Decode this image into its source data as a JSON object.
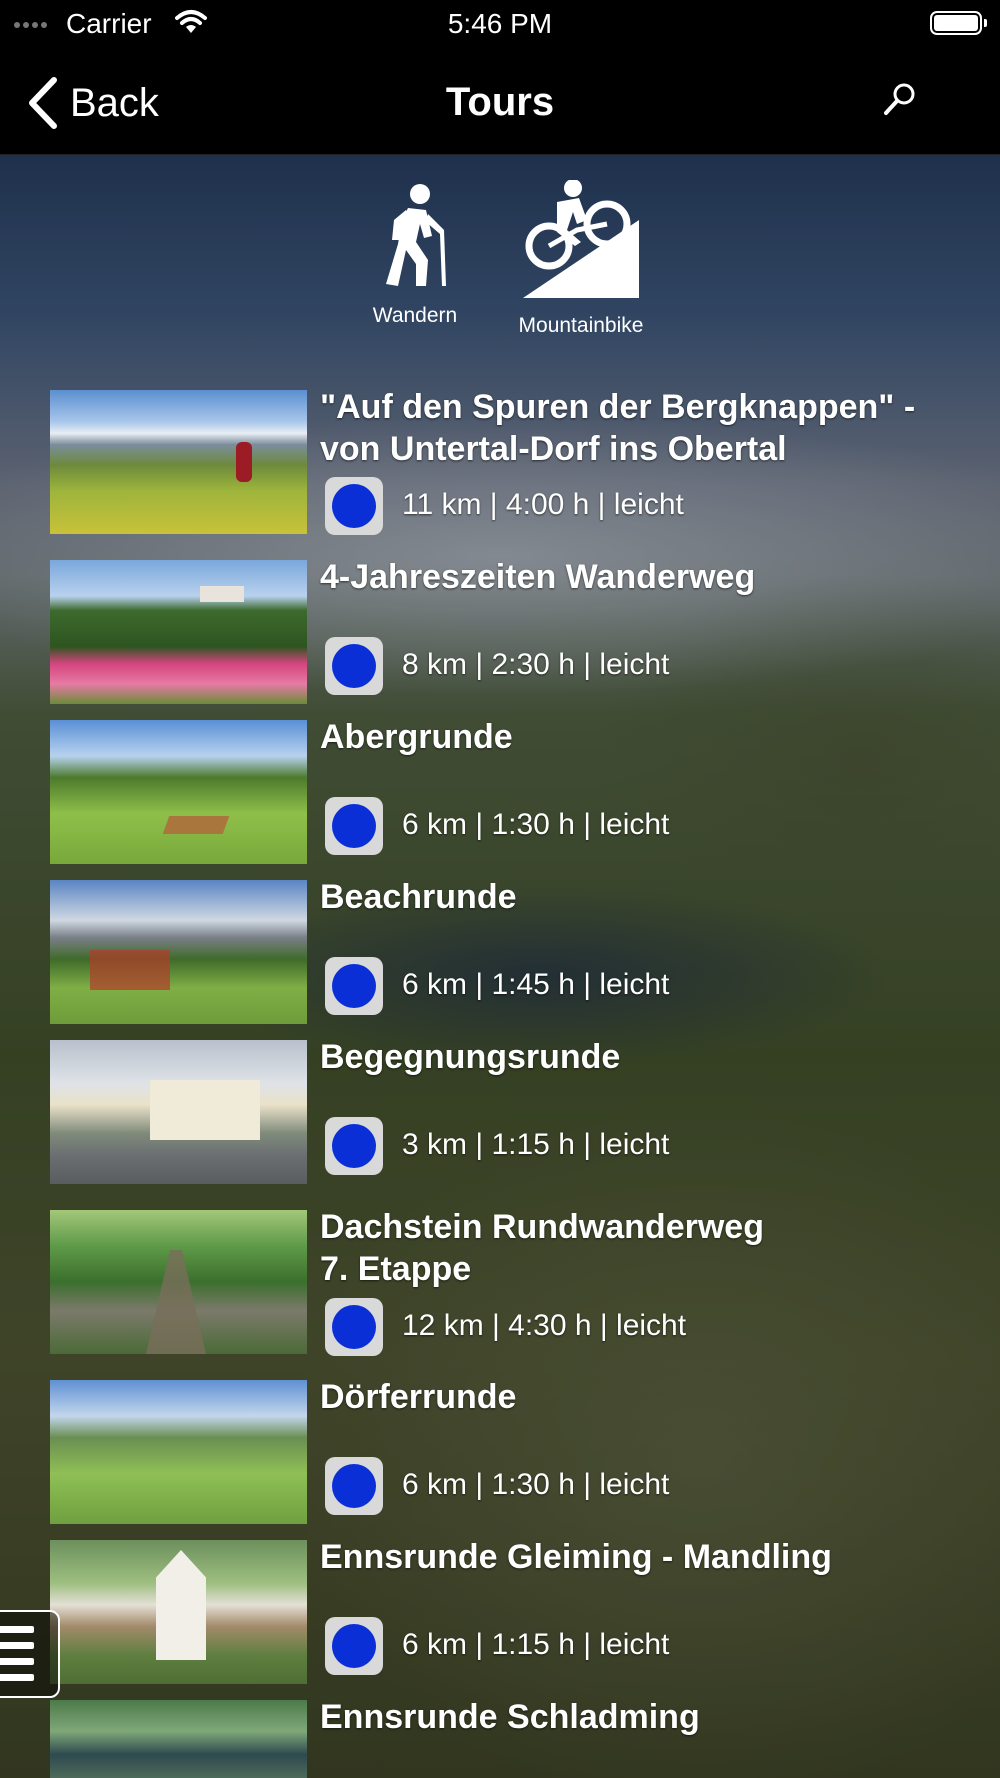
{
  "status_bar": {
    "carrier": "Carrier",
    "time": "5:46 PM"
  },
  "nav": {
    "back_label": "Back",
    "title": "Tours"
  },
  "categories": [
    {
      "label": "Wandern",
      "icon": "hiking-icon"
    },
    {
      "label": "Mountainbike",
      "icon": "mountainbike-icon"
    }
  ],
  "tours": [
    {
      "title": "\"Auf den Spuren der Bergknappen\" -\nvon Untertal-Dorf ins Obertal",
      "meta": "11 km | 4:00 h | leicht"
    },
    {
      "title": "4-Jahreszeiten Wanderweg",
      "meta": "8 km | 2:30 h | leicht"
    },
    {
      "title": "Abergrunde",
      "meta": "6 km | 1:30 h | leicht"
    },
    {
      "title": "Beachrunde",
      "meta": "6 km | 1:45 h | leicht"
    },
    {
      "title": "Begegnungsrunde",
      "meta": "3 km | 1:15 h | leicht"
    },
    {
      "title": "Dachstein Rundwanderweg\n7. Etappe",
      "meta": "12 km | 4:30 h | leicht"
    },
    {
      "title": "Dörferrunde",
      "meta": "6 km | 1:30 h | leicht"
    },
    {
      "title": "Ennsrunde Gleiming - Mandling",
      "meta": "6 km | 1:15 h | leicht"
    },
    {
      "title": "Ennsrunde Schladming",
      "meta": ""
    }
  ],
  "colors": {
    "difficulty_easy": "#0a2fd6",
    "nav_background": "#000000"
  }
}
